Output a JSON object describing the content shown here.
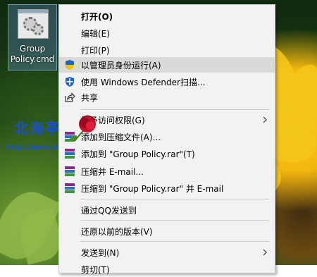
{
  "desktop": {
    "file_label": "Group\nPolicy.cmd",
    "watermark_text": "北海亭",
    "watermark_url": "http://www.beihaiting"
  },
  "menu": {
    "items": [
      {
        "label": "打开(O)"
      },
      {
        "label": "编辑(E)"
      },
      {
        "label": "打印(P)"
      },
      {
        "label": "以管理员身份运行(A)"
      },
      {
        "label": "使用 Windows Defender扫描..."
      },
      {
        "label": "共享"
      },
      {
        "label": "授予访问权限(G)"
      },
      {
        "label": "添加到压缩文件(A)..."
      },
      {
        "label": "添加到 \"Group Policy.rar\"(T)"
      },
      {
        "label": "压缩并 E-mail..."
      },
      {
        "label": "压缩到 \"Group Policy.rar\" 并 E-mail"
      },
      {
        "label": "通过QQ发送到"
      },
      {
        "label": "还原以前的版本(V)"
      },
      {
        "label": "发送到(N)"
      },
      {
        "label": "剪切(T)"
      }
    ]
  },
  "colors": {
    "menu_bg": "#f2f2f2",
    "highlight": "#dadada",
    "watermark": "#1a4fd1",
    "shield_blue": "#1e63c8",
    "shield_yellow": "#f2c300"
  },
  "icons": [
    "shield-uac-icon",
    "defender-shield-icon",
    "share-icon",
    "winrar-icon",
    "chevron-right-icon",
    "gear-icon"
  ]
}
